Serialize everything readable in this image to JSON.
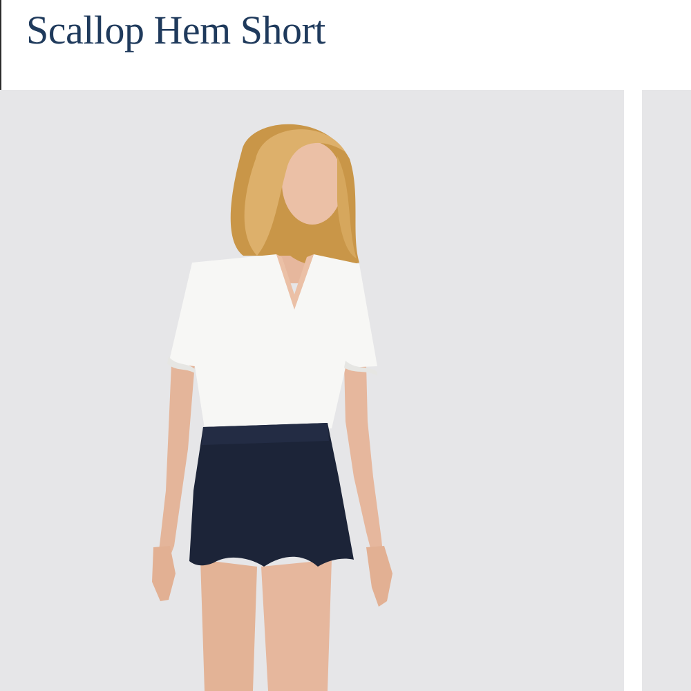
{
  "product": {
    "title": "Scallop Hem Short"
  },
  "gallery": {
    "images": [
      {
        "subject": "model-wearing-scallop-hem-short",
        "active": true
      },
      {
        "subject": "next-product-image",
        "active": false
      }
    ],
    "colors": {
      "background": "#e6e6e8",
      "short": "#1c2438",
      "top": "#f7f7f5",
      "hair": "#d8aa62",
      "skin": "#e6b79d",
      "title": "#1f3a5c"
    }
  }
}
